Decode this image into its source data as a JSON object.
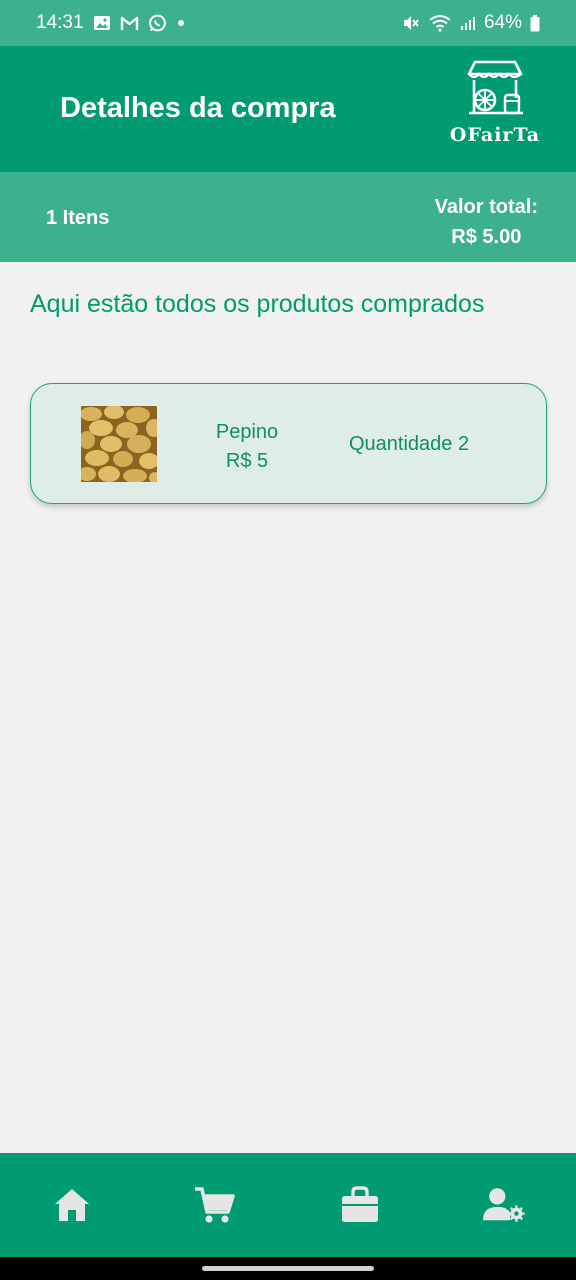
{
  "status_bar": {
    "time": "14:31",
    "battery": "64%",
    "icons": [
      "image-icon",
      "gmail-icon",
      "whatsapp-icon",
      "dot-icon",
      "mute-icon",
      "wifi-icon",
      "signal-icon",
      "battery-icon"
    ]
  },
  "header": {
    "title": "Detalhes da compra",
    "brand": "OFairTa",
    "logo_icon": "market-stall-icon"
  },
  "summary": {
    "items": "1 Itens",
    "total_label": "Valor total:",
    "total_value": "R$ 5.00"
  },
  "main": {
    "intro": "Aqui estão todos os produtos comprados",
    "products": [
      {
        "name": "Pepino",
        "price": "R$ 5",
        "quantity": "Quantidade 2",
        "image_icon": "potatoes-image"
      }
    ]
  },
  "bottom_nav": {
    "items": [
      {
        "icon": "home-icon"
      },
      {
        "icon": "cart-icon"
      },
      {
        "icon": "shopping-bag-icon"
      },
      {
        "icon": "user-settings-icon"
      }
    ]
  },
  "colors": {
    "primary": "#009b70",
    "primary_light": "#3db08e",
    "card_bg": "#deede8",
    "text_accent": "#0f8f69",
    "nav_icon": "#e8e8e8",
    "background": "#f1f1f1"
  }
}
